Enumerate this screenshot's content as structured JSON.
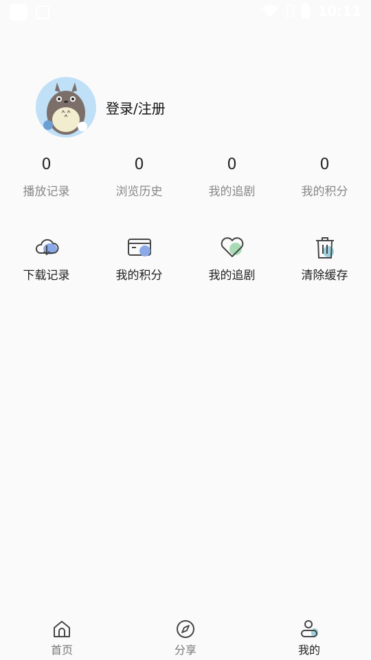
{
  "status_bar": {
    "time": "10:11"
  },
  "profile": {
    "login_text": "登录/注册"
  },
  "stats": [
    {
      "value": "0",
      "label": "播放记录"
    },
    {
      "value": "0",
      "label": "浏览历史"
    },
    {
      "value": "0",
      "label": "我的追剧"
    },
    {
      "value": "0",
      "label": "我的积分"
    }
  ],
  "actions": [
    {
      "label": "下载记录",
      "icon": "cloud-download-icon"
    },
    {
      "label": "我的积分",
      "icon": "card-icon"
    },
    {
      "label": "我的追剧",
      "icon": "heart-icon"
    },
    {
      "label": "清除缓存",
      "icon": "trash-icon"
    }
  ],
  "tabs": [
    {
      "label": "首页",
      "icon": "home-icon",
      "active": false
    },
    {
      "label": "分享",
      "icon": "compass-icon",
      "active": false
    },
    {
      "label": "我的",
      "icon": "user-icon",
      "active": true
    }
  ],
  "colors": {
    "accent_blue": "#8aa9e6",
    "accent_green": "#a8dbb4",
    "avatar_bg": "#bfe0f7"
  }
}
